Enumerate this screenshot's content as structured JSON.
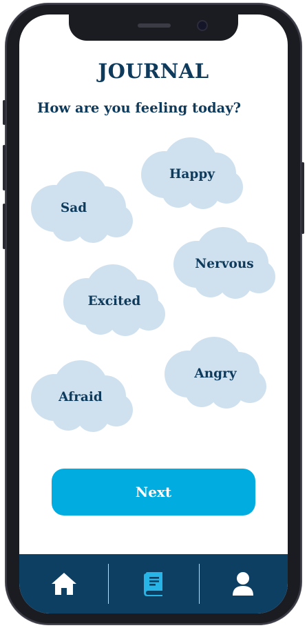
{
  "header": {
    "title": "JOURNAL",
    "question": "How are you feeling today?"
  },
  "moods": [
    {
      "label": "Happy",
      "name": "happy"
    },
    {
      "label": "Sad",
      "name": "sad"
    },
    {
      "label": "Nervous",
      "name": "nervous"
    },
    {
      "label": "Excited",
      "name": "excited"
    },
    {
      "label": "Angry",
      "name": "angry"
    },
    {
      "label": "Afraid",
      "name": "afraid"
    }
  ],
  "actions": {
    "next_label": "Next"
  },
  "nav": {
    "items": [
      {
        "icon": "home-icon",
        "active": false
      },
      {
        "icon": "journal-icon",
        "active": true
      },
      {
        "icon": "profile-icon",
        "active": false
      }
    ]
  },
  "colors": {
    "primary_text": "#0e3a5c",
    "cloud": "#cfe1ef",
    "accent": "#00ace0",
    "nav_background": "#0d3f63",
    "nav_active": "#27b4e6",
    "nav_inactive": "#ffffff"
  }
}
